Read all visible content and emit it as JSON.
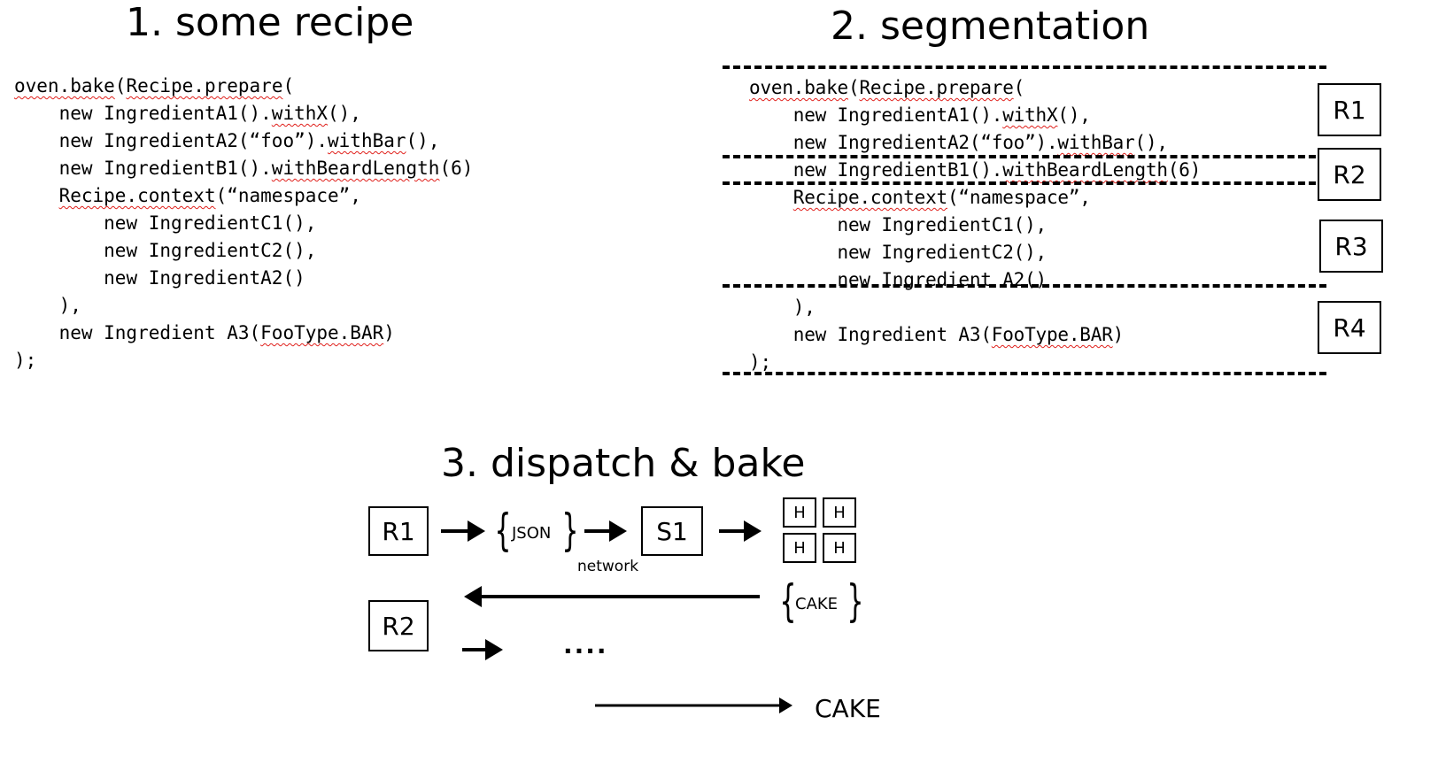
{
  "sections": {
    "recipe_title": "1. some recipe",
    "segmentation_title": "2. segmentation",
    "dispatch_title": "3. dispatch & bake"
  },
  "recipe_code": [
    {
      "indent": "",
      "parts": [
        {
          "t": "oven.bake",
          "sq": true
        },
        {
          "t": "(",
          "sq": false
        },
        {
          "t": "Recipe.prepare",
          "sq": true
        },
        {
          "t": "(",
          "sq": false
        }
      ]
    },
    {
      "indent": "    ",
      "parts": [
        {
          "t": "new IngredientA1().",
          "sq": false
        },
        {
          "t": "withX",
          "sq": true
        },
        {
          "t": "(),",
          "sq": false
        }
      ]
    },
    {
      "indent": "    ",
      "parts": [
        {
          "t": "new IngredientA2(“foo”).",
          "sq": false
        },
        {
          "t": "withBar",
          "sq": true
        },
        {
          "t": "(),",
          "sq": false
        }
      ]
    },
    {
      "indent": "    ",
      "parts": [
        {
          "t": "new IngredientB1().",
          "sq": false
        },
        {
          "t": "withBeardLength",
          "sq": true
        },
        {
          "t": "(6)",
          "sq": false
        }
      ]
    },
    {
      "indent": "    ",
      "parts": [
        {
          "t": "Recipe.context",
          "sq": true
        },
        {
          "t": "(“namespace”,",
          "sq": false
        }
      ]
    },
    {
      "indent": "        ",
      "parts": [
        {
          "t": "new IngredientC1(),",
          "sq": false
        }
      ]
    },
    {
      "indent": "        ",
      "parts": [
        {
          "t": "new IngredientC2(),",
          "sq": false
        }
      ]
    },
    {
      "indent": "        ",
      "parts": [
        {
          "t": "new IngredientA2()",
          "sq": false
        }
      ]
    },
    {
      "indent": "    ",
      "parts": [
        {
          "t": "),",
          "sq": false
        }
      ]
    },
    {
      "indent": "    ",
      "parts": [
        {
          "t": "new Ingredient A3(",
          "sq": false
        },
        {
          "t": "FooType.BAR",
          "sq": true
        },
        {
          "t": ")",
          "sq": false
        }
      ]
    },
    {
      "indent": "",
      "parts": [
        {
          "t": ");",
          "sq": false
        }
      ]
    }
  ],
  "segmentation_code": [
    {
      "indent": "",
      "parts": [
        {
          "t": "oven.bake",
          "sq": true
        },
        {
          "t": "(",
          "sq": false
        },
        {
          "t": "Recipe.prepare",
          "sq": true
        },
        {
          "t": "(",
          "sq": false
        }
      ]
    },
    {
      "indent": "    ",
      "parts": [
        {
          "t": "new IngredientA1().",
          "sq": false
        },
        {
          "t": "withX",
          "sq": true
        },
        {
          "t": "(),",
          "sq": false
        }
      ]
    },
    {
      "indent": "    ",
      "parts": [
        {
          "t": "new IngredientA2(“foo”).",
          "sq": false
        },
        {
          "t": "withBar",
          "sq": true
        },
        {
          "t": "(),",
          "sq": false
        }
      ]
    },
    {
      "indent": "    ",
      "parts": [
        {
          "t": "new IngredientB1().",
          "sq": false
        },
        {
          "t": "withBeardLength",
          "sq": true
        },
        {
          "t": "(6)",
          "sq": false
        }
      ]
    },
    {
      "indent": "    ",
      "parts": [
        {
          "t": "Recipe.context",
          "sq": true
        },
        {
          "t": "(“namespace”,",
          "sq": false
        }
      ]
    },
    {
      "indent": "        ",
      "parts": [
        {
          "t": "new IngredientC1(),",
          "sq": false
        }
      ]
    },
    {
      "indent": "        ",
      "parts": [
        {
          "t": "new IngredientC2(),",
          "sq": false
        }
      ]
    },
    {
      "indent": "        ",
      "parts": [
        {
          "t": "new Ingredient A2()",
          "sq": false
        }
      ]
    },
    {
      "indent": "    ",
      "parts": [
        {
          "t": "),",
          "sq": false
        }
      ]
    },
    {
      "indent": "    ",
      "parts": [
        {
          "t": "new Ingredient A3(",
          "sq": false
        },
        {
          "t": "FooType.BAR",
          "sq": true
        },
        {
          "t": ")",
          "sq": false
        }
      ]
    },
    {
      "indent": "",
      "parts": [
        {
          "t": ");",
          "sq": false
        }
      ]
    }
  ],
  "segments": [
    "R1",
    "R2",
    "R3",
    "R4"
  ],
  "dispatch": {
    "r1": "R1",
    "json": "JSON",
    "network": "network",
    "s1": "S1",
    "handlers": [
      "H",
      "H",
      "H",
      "H"
    ],
    "cake_payload": "CAKE",
    "r2": "R2",
    "ellipsis": "....",
    "result": "CAKE"
  }
}
